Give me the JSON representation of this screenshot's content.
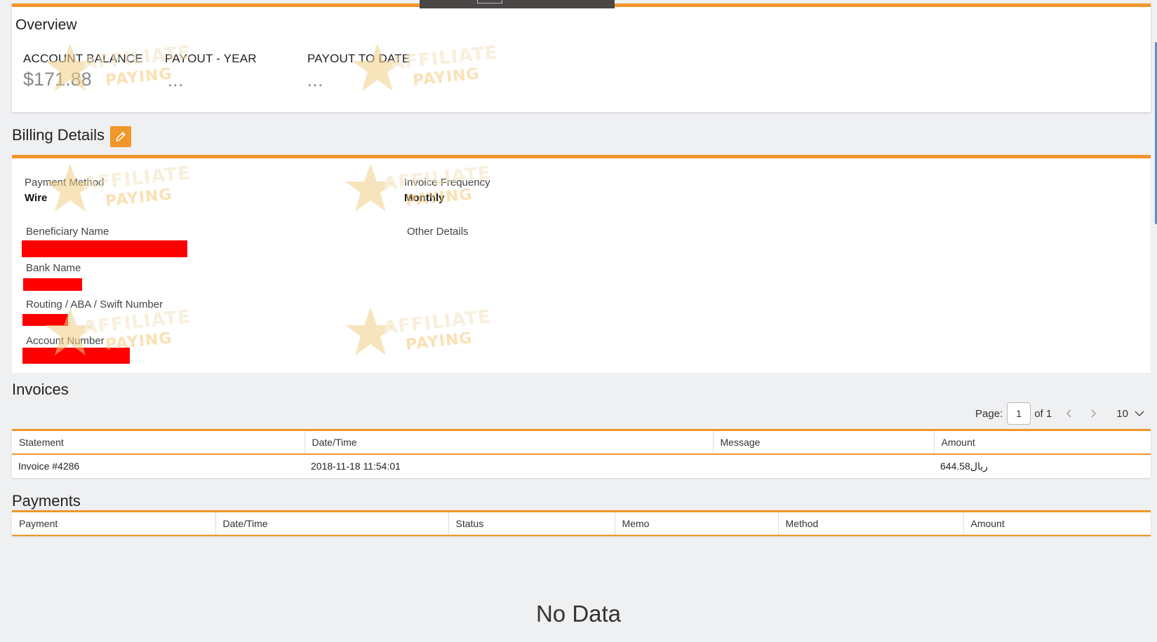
{
  "overview": {
    "title": "Overview",
    "stats": [
      {
        "label": "ACCOUNT BALANCE",
        "value": "$171.88"
      },
      {
        "label": "PAYOUT - YEAR",
        "value": "..."
      },
      {
        "label": "PAYOUT TO DATE",
        "value": "..."
      }
    ]
  },
  "billing": {
    "title": "Billing Details",
    "payment_method_label": "Payment Method",
    "payment_method_value": "Wire",
    "invoice_frequency_label": "Invoice Frequency",
    "invoice_frequency_value": "Monthly",
    "beneficiary_name_label": "Beneficiary Name",
    "other_details_label": "Other Details",
    "bank_name_label": "Bank Name",
    "routing_label": "Routing / ABA / Swift Number",
    "account_number_label": "Account Number"
  },
  "invoices": {
    "title": "Invoices",
    "pager": {
      "page_label": "Page:",
      "page": "1",
      "of_label": "of 1",
      "per_page": "10"
    },
    "columns": [
      "Statement",
      "Date/Time",
      "Message",
      "Amount"
    ],
    "rows": [
      {
        "statement": "Invoice #4286",
        "datetime": "2018-11-18 11:54:01",
        "message": "",
        "amount": "644.58ريال"
      }
    ]
  },
  "payments": {
    "title": "Payments",
    "columns": [
      "Payment",
      "Date/Time",
      "Status",
      "Memo",
      "Method",
      "Amount"
    ],
    "empty_text": "No Data"
  },
  "watermark": {
    "line1": "AFFILIATE",
    "line2": "PAYING"
  },
  "colors": {
    "accent": "#f0962a",
    "redaction": "#ff0000",
    "background": "#eff0f2"
  }
}
